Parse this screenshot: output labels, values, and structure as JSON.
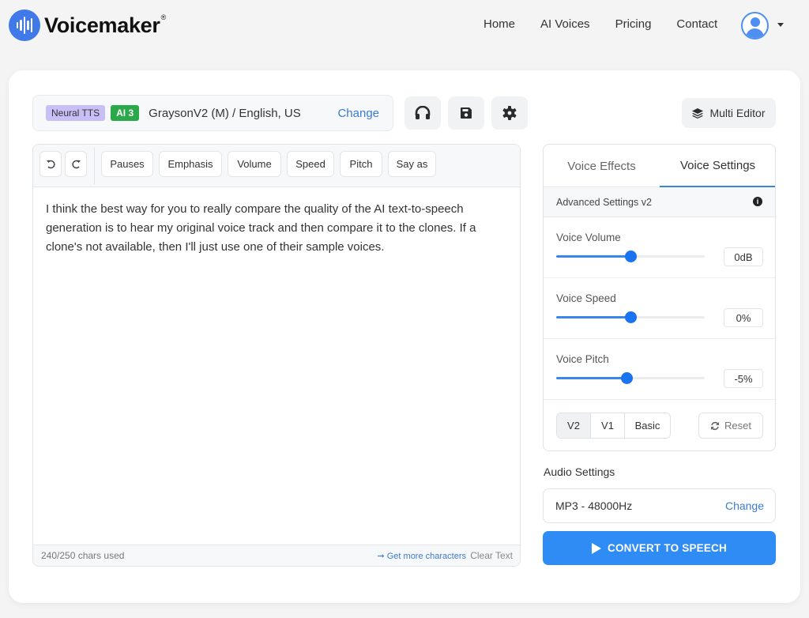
{
  "brand": {
    "name": "Voicemaker",
    "reg_mark": "®",
    "logo_icon": "sound-wave-icon",
    "accent": "#3f7ae8"
  },
  "nav": {
    "items": [
      {
        "label": "Home"
      },
      {
        "label": "AI Voices"
      },
      {
        "label": "Pricing"
      },
      {
        "label": "Contact"
      }
    ],
    "user_icon": "user-avatar-icon",
    "menu_icon": "caret-down-icon"
  },
  "voice": {
    "engine_badge": "Neural TTS",
    "engine_badge_color": "#c8bff6",
    "tier_badge": "AI 3",
    "tier_badge_color": "#2ba84a",
    "name": "GraysonV2 (M) / English, US",
    "change_label": "Change"
  },
  "toolbar": {
    "icons": [
      "headphones-icon",
      "save-icon",
      "gear-icon"
    ],
    "multi_editor_label": "Multi Editor",
    "multi_editor_icon": "layers-icon"
  },
  "editor": {
    "undo_icon": "undo-icon",
    "redo_icon": "redo-icon",
    "tools": [
      {
        "label": "Pauses"
      },
      {
        "label": "Emphasis"
      },
      {
        "label": "Volume"
      },
      {
        "label": "Speed"
      },
      {
        "label": "Pitch"
      },
      {
        "label": "Say as"
      }
    ],
    "text": "I think the best way for you to really compare the quality of the AI text-to-speech generation is to hear my original voice track and then compare it to the clones. If a clone's not available, then I'll just use one of their sample voices.",
    "chars_used": "240/250 chars used",
    "more_chars_label": "➞ Get more characters",
    "clear_label": "Clear Text"
  },
  "settings": {
    "tabs": [
      {
        "label": "Voice Effects",
        "active": false
      },
      {
        "label": "Voice Settings",
        "active": true
      }
    ],
    "advanced_label": "Advanced Settings v2",
    "info_icon": "info-icon",
    "sliders": [
      {
        "label": "Voice Volume",
        "value": "0dB",
        "fraction": 0.5
      },
      {
        "label": "Voice Speed",
        "value": "0%",
        "fraction": 0.5
      },
      {
        "label": "Voice Pitch",
        "value": "-5%",
        "fraction": 0.475
      }
    ],
    "versions": [
      {
        "label": "V2",
        "active": true
      },
      {
        "label": "V1",
        "active": false
      },
      {
        "label": "Basic",
        "active": false
      }
    ],
    "reset_label": "Reset",
    "reset_icon": "refresh-icon"
  },
  "audio": {
    "section_label": "Audio Settings",
    "format": "MP3 - 48000Hz",
    "change_label": "Change"
  },
  "convert": {
    "label": "CONVERT TO SPEECH",
    "icon": "play-icon",
    "color": "#2f8cf4"
  }
}
